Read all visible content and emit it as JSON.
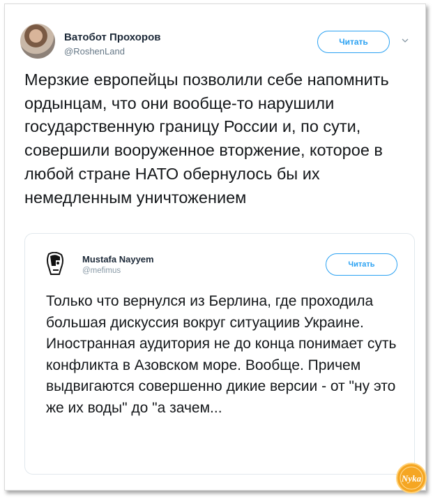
{
  "tweet": {
    "author_name": "Ватобот Прохоров",
    "author_handle": "@RoshenLand",
    "follow_label": "Читать",
    "text": "Мерзкие европейцы позволили себе напомнить ордынцам, что они вообще-то нарушили государственную границу России и, по сути, совершили вооруженное вторжение, которое в любой стране НАТО обернулось бы их немедленным уничтожением"
  },
  "quoted_tweet": {
    "author_name": "Mustafa Nayyem",
    "author_handle": "@mefimus",
    "follow_label": "Читать",
    "text": "Только что вернулся из Берлина, где проходила большая дискуссия вокруг ситуациив Украине. Иностранная аудитория не до конца понимает суть конфликта в Азовском море. Вообще. Причем выдвигаются совершенно дикие версии - от \"ну это же их воды\" до \"а зачем..."
  },
  "watermark": {
    "text": "Nyka"
  },
  "colors": {
    "accent": "#2aa1f2",
    "text": "#14171a",
    "secondary": "#657786",
    "border": "#e1e8ed",
    "watermark": "#f0a020"
  },
  "icons": [
    "avatar",
    "chevron-down-icon",
    "quoted-avatar",
    "nyka-logo"
  ]
}
